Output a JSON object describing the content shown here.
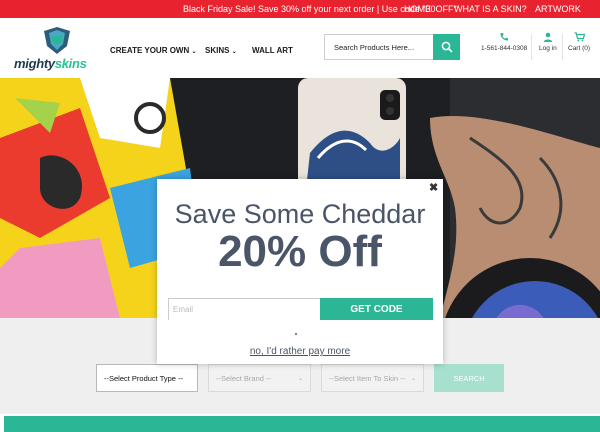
{
  "promo": {
    "text": "Black Friday Sale! Save 30% off your next order | Use code \"30OFF\"",
    "links": [
      "HOME",
      "WHAT IS A SKIN?",
      "ARTWORK"
    ]
  },
  "header": {
    "logo_part1": "mighty",
    "logo_part2": "skins",
    "nav": [
      "CREATE YOUR OWN",
      "SKINS",
      "WALL ART"
    ],
    "search_placeholder": "Search Products Here...",
    "phone": "1-561-844-0308",
    "login": "Log in",
    "cart": "Cart (0)"
  },
  "modal": {
    "headline": "Save Some Cheddar",
    "offer": "20% Off",
    "email_placeholder": "Email",
    "get_code": "GET CODE",
    "decline": "no, I'd rather pay more"
  },
  "filter": {
    "product_type": "--Select Product Type --",
    "brand": "--Select Brand --",
    "item": "--Select Item To Skin --",
    "search": "SEARCH"
  },
  "colors": {
    "promo_bar": "#e8232f",
    "accent": "#2bb796",
    "navy": "#1f3b52",
    "heading": "#4a5568"
  },
  "icons": [
    "search-icon",
    "phone-icon",
    "user-icon",
    "cart-icon",
    "close-icon",
    "chevron-down-icon"
  ]
}
